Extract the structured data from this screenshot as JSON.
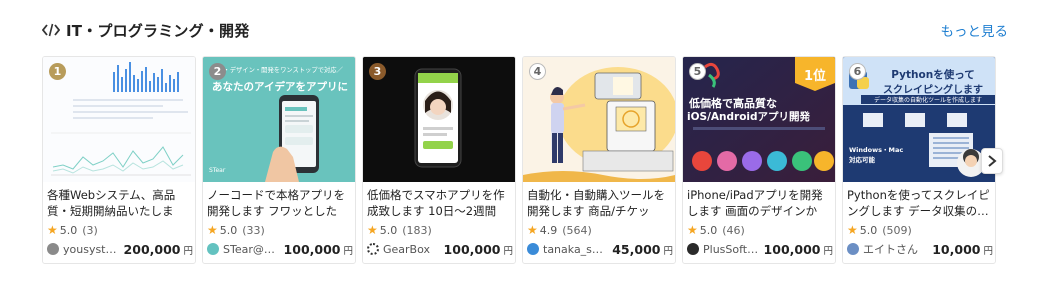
{
  "section": {
    "title": "IT・プログラミング・開発",
    "see_more": "もっと見る",
    "icon": "code-icon"
  },
  "currency": "円",
  "cards": [
    {
      "rank": "1",
      "title": "各種Webシステム、高品質・短期開納品いたします…",
      "rating": "5.0",
      "count": "(3)",
      "seller": "yousystem",
      "price": "200,000",
      "rank_color": "#b89c5b"
    },
    {
      "rank": "2",
      "title": "ノーコードで本格アプリを開発します フワッとした構…",
      "rating": "5.0",
      "count": "(33)",
      "seller": "STear@ア…",
      "price": "100,000",
      "rank_color": "#8c8c8c",
      "thumb_top": "画・デザイン・開発をワンストップで対応／",
      "thumb_main": "あなたのアイデアをアプリに",
      "thumb_logo": "STear"
    },
    {
      "rank": "3",
      "title": "低価格でスマホアプリを作成致します 10日〜2週間程…",
      "rating": "5.0",
      "count": "(183)",
      "seller": "GearBox",
      "price": "100,000",
      "rank_color": "#8a5a2b"
    },
    {
      "rank": "4",
      "title": "自動化・自動購入ツールを開発します 商品/チケット/…",
      "rating": "4.9",
      "count": "(564)",
      "seller": "tanaka_s_…",
      "price": "45,000",
      "rank_color": "#bdbdbd"
    },
    {
      "rank": "5",
      "title": "iPhone/iPadアプリを開発します 画面のデザインから…",
      "rating": "5.0",
      "count": "(46)",
      "seller": "PlusSoftw…",
      "price": "100,000",
      "rank_color": "#bdbdbd",
      "thumb_badge": "1位",
      "thumb_main1": "低価格で高品質な",
      "thumb_main2": "iOS/Androidアプリ開発"
    },
    {
      "rank": "6",
      "title": "Pythonを使ってスクレイピングします データ収集の…",
      "rating": "5.0",
      "count": "(509)",
      "seller": "エイトさん",
      "price": "10,000",
      "rank_color": "#bdbdbd",
      "thumb_main1": "Pythonを使って",
      "thumb_main2": "スクレイピングします",
      "thumb_sub": "データ収集の自動化ツールを作成します",
      "thumb_tag": "Windows・Mac対応可能"
    }
  ]
}
